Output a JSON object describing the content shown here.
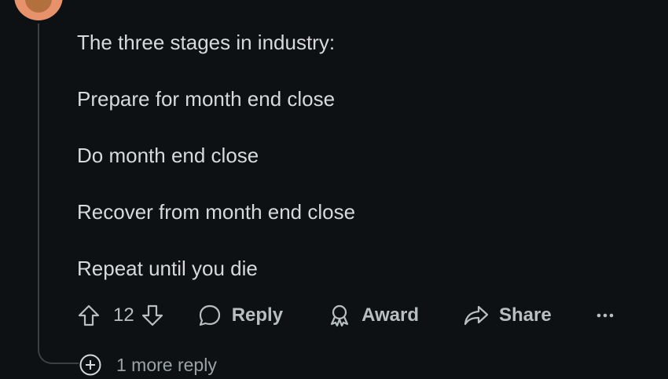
{
  "comment": {
    "paragraphs": [
      "The three stages in industry:",
      "Prepare for month end close",
      "Do month end close",
      "Recover from month end close",
      "Repeat until you die"
    ]
  },
  "actions": {
    "vote_count": "12",
    "reply_label": "Reply",
    "award_label": "Award",
    "share_label": "Share",
    "more_label": "..."
  },
  "more_replies": {
    "label": "1 more reply"
  },
  "colors": {
    "background": "#0e1113",
    "text": "#d7dadc",
    "muted": "#b8bfc3",
    "avatar": "#e8926b"
  },
  "icons": [
    "upvote-icon",
    "downvote-icon",
    "comment-bubble-icon",
    "award-icon",
    "share-arrow-icon",
    "more-dots-icon",
    "plus-circle-icon"
  ]
}
